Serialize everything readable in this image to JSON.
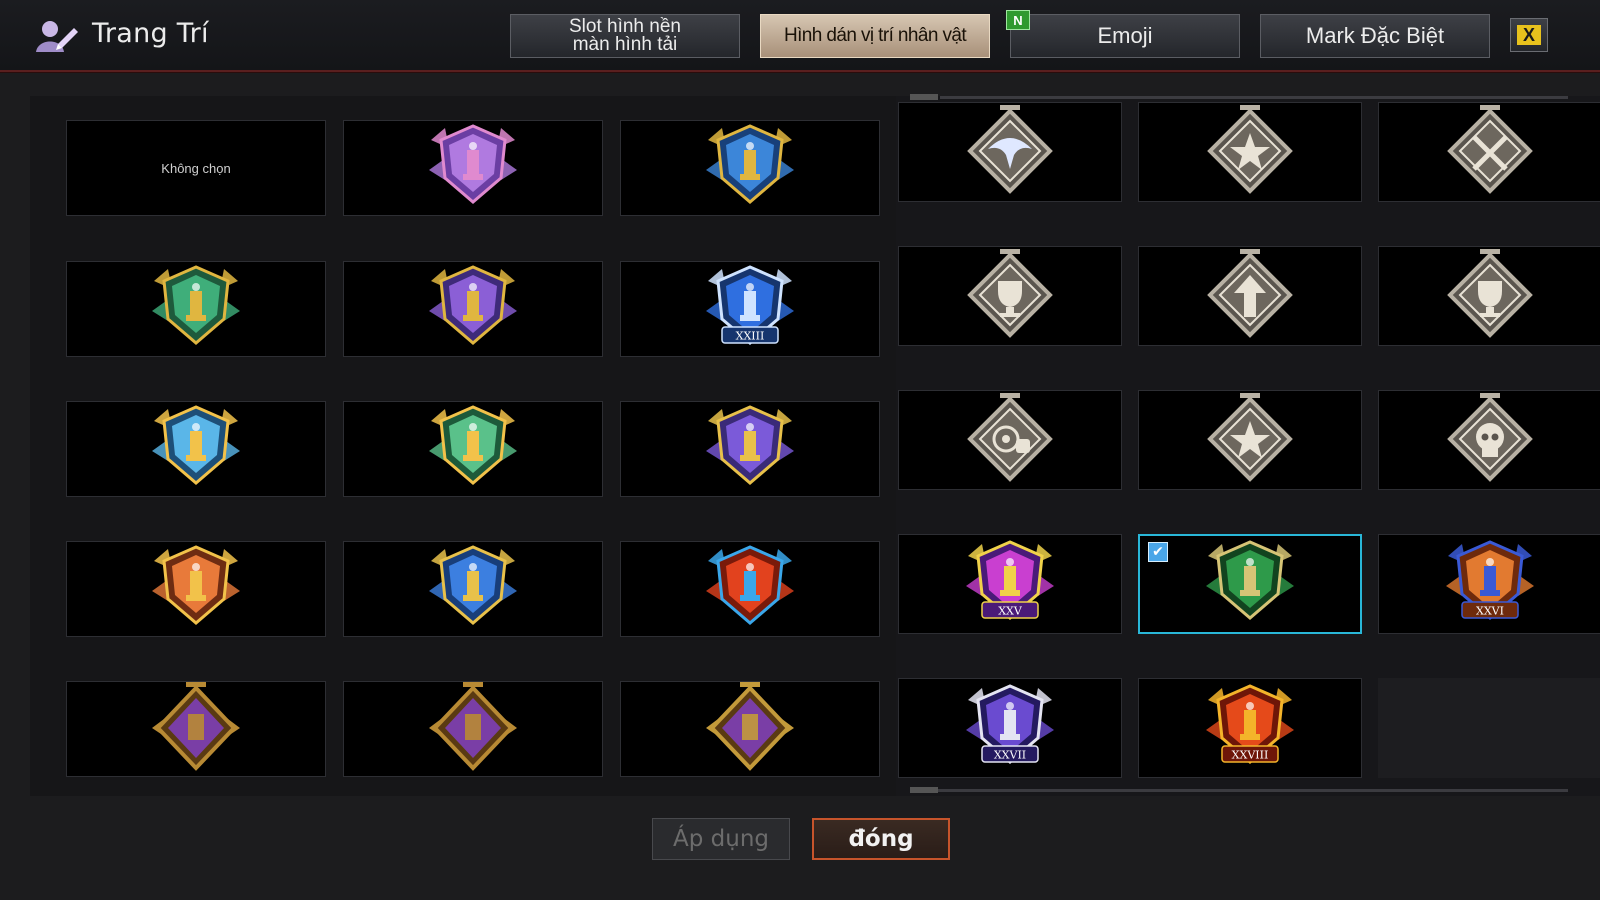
{
  "header": {
    "title": "Trang Trí",
    "tabs": [
      {
        "label": "Slot hình nền\nmàn hình tải",
        "active": false
      },
      {
        "label": "Hình dán vị trí nhân vật",
        "active": true
      },
      {
        "label": "Emoji",
        "active": false,
        "new_badge": "N"
      },
      {
        "label": "Mark Đặc Biệt",
        "active": false
      }
    ],
    "close_glyph": "X"
  },
  "left_grid": {
    "rows": [
      [
        {
          "icon": "none",
          "label": "Không chọn"
        },
        {
          "icon": "purple-diamond-crest-icon"
        },
        {
          "icon": "blue-gold-tower-crest-icon"
        }
      ],
      [
        {
          "icon": "green-gold-tower-crest-icon"
        },
        {
          "icon": "purple-gold-tower-crest-icon"
        },
        {
          "icon": "blue-diamond-xxiii-crest-icon",
          "roman": "XXIII"
        }
      ],
      [
        {
          "icon": "light-blue-tower-crest-icon"
        },
        {
          "icon": "green-tower-crest-icon"
        },
        {
          "icon": "purple-gold-winged-crest-icon"
        }
      ],
      [
        {
          "icon": "orange-tower-crest-icon"
        },
        {
          "icon": "blue-winged-tower-crest-icon"
        },
        {
          "icon": "fire-ice-dragon-crest-icon"
        }
      ],
      [
        {
          "icon": "gold-medal-warrior-icon"
        },
        {
          "icon": "gold-medal-figures-icon"
        },
        {
          "icon": "gold-medal-trophy-icon"
        }
      ]
    ]
  },
  "right_grid": {
    "rows": [
      [
        {
          "icon": "silver-eagle-medal-icon"
        },
        {
          "icon": "silver-star-medal-icon"
        },
        {
          "icon": "silver-crossed-swords-medal-icon"
        }
      ],
      [
        {
          "icon": "silver-trophy-wreath-medal-icon"
        },
        {
          "icon": "silver-arrow-medal-icon"
        },
        {
          "icon": "silver-cup-medal-icon"
        }
      ],
      [
        {
          "icon": "silver-target-fist-medal-icon"
        },
        {
          "icon": "silver-star-plus-medal-icon"
        },
        {
          "icon": "silver-skull-medal-icon"
        }
      ],
      [
        {
          "icon": "neon-trophy-xxv-icon",
          "roman": "XXV"
        },
        {
          "icon": "green-shield-crest-icon",
          "selected": true
        },
        {
          "icon": "orange-trophy-xxvi-icon",
          "roman": "XXVI"
        }
      ],
      [
        {
          "icon": "purple-wolf-xxvii-icon",
          "roman": "XXVII"
        },
        {
          "icon": "flame-xxviii-icon",
          "roman": "XXVIII"
        },
        {
          "icon": "empty"
        }
      ]
    ]
  },
  "footer": {
    "apply_label": "Áp dụng",
    "close_label": "đóng"
  },
  "colors": {
    "selection": "#29b7d8",
    "close_btn_border": "#c7542b",
    "header_divider": "#5a1f1f",
    "new_badge": "#2f9a2f"
  }
}
